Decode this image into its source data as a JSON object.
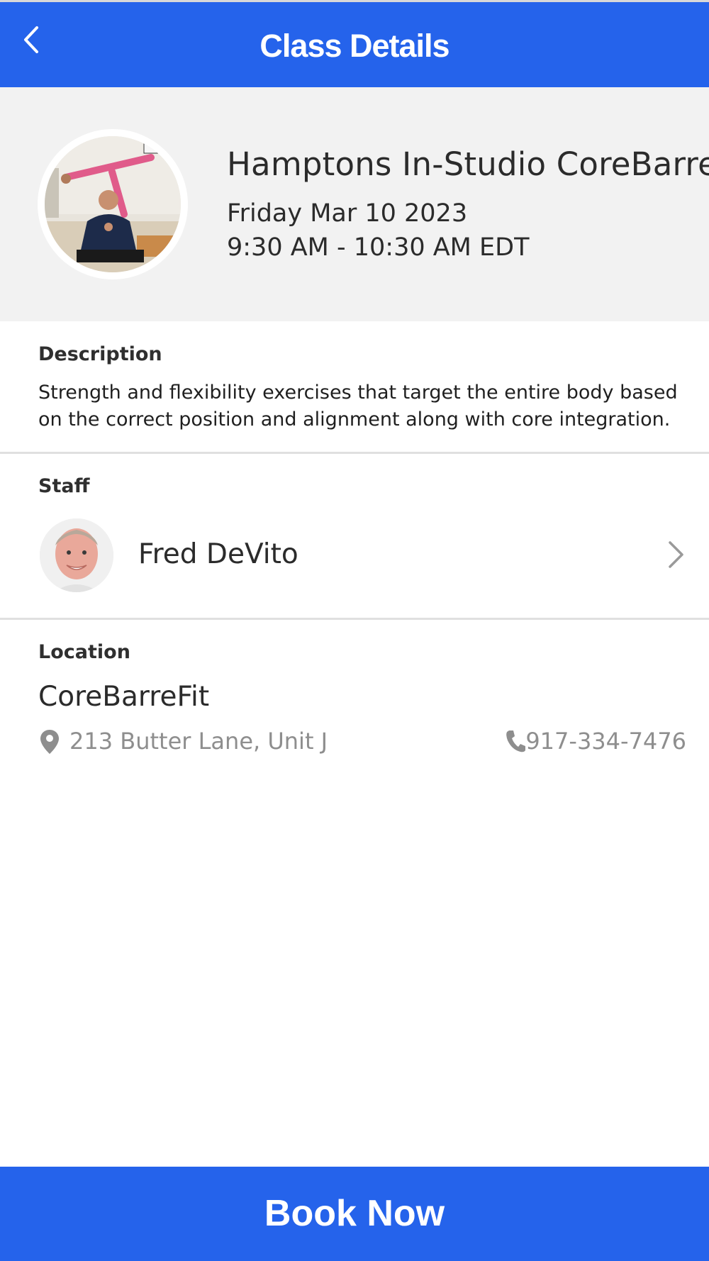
{
  "header": {
    "title": "Class Details",
    "back_icon": "chevron-left-icon",
    "background": "#2563eb"
  },
  "class_info": {
    "image": "class-photo",
    "title": "Hamptons In-Studio CoreBarre",
    "date": "Friday Mar 10 2023",
    "time": "9:30 AM - 10:30 AM EDT"
  },
  "description": {
    "label": "Description",
    "text": "Strength and flexibility exercises that target the entire body based on the correct position and alignment along with core integration."
  },
  "staff": {
    "label": "Staff",
    "name": "Fred DeVito",
    "avatar": "staff-avatar",
    "chevron_icon": "chevron-right-icon"
  },
  "location": {
    "label": "Location",
    "name": "CoreBarreFit",
    "address": "213 Butter Lane, Unit J",
    "address_icon": "map-pin-icon",
    "phone": "917-334-7476",
    "phone_icon": "phone-icon"
  },
  "footer": {
    "book_label": "Book Now",
    "background": "#2563eb"
  }
}
